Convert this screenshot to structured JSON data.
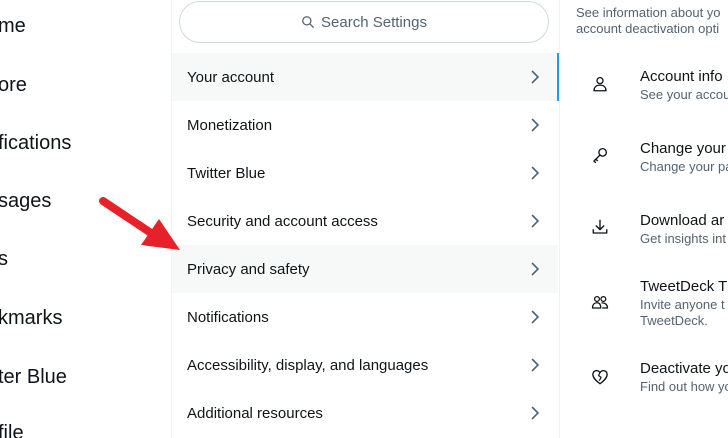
{
  "left_nav": {
    "items": [
      {
        "label": "me"
      },
      {
        "label": "ore"
      },
      {
        "label": "fications"
      },
      {
        "label": "sages"
      },
      {
        "label": "s"
      },
      {
        "label": "kmarks"
      },
      {
        "label": "ter Blue"
      },
      {
        "label": "file"
      }
    ]
  },
  "settings": {
    "search_placeholder": "Search Settings",
    "items": [
      {
        "label": "Your account"
      },
      {
        "label": "Monetization"
      },
      {
        "label": "Twitter Blue"
      },
      {
        "label": "Security and account access"
      },
      {
        "label": "Privacy and safety"
      },
      {
        "label": "Notifications"
      },
      {
        "label": "Accessibility, display, and languages"
      },
      {
        "label": "Additional resources"
      }
    ]
  },
  "details": {
    "intro_line1": "See information about yo",
    "intro_line2": "account deactivation opti",
    "items": [
      {
        "title": "Account info",
        "subtitle": "See your accou",
        "icon": "person-icon"
      },
      {
        "title": "Change your",
        "subtitle": "Change your pa",
        "icon": "key-icon"
      },
      {
        "title": "Download ar",
        "subtitle": "Get insights int",
        "icon": "download-icon"
      },
      {
        "title": "TweetDeck T",
        "subtitle": "Invite anyone t",
        "subtitle2": "TweetDeck.",
        "icon": "people-icon"
      },
      {
        "title": "Deactivate yo",
        "subtitle": "Find out how yo",
        "icon": "broken-heart-icon"
      }
    ]
  },
  "colors": {
    "accent": "#1d9bf0",
    "annotation_arrow": "#e8202a"
  }
}
